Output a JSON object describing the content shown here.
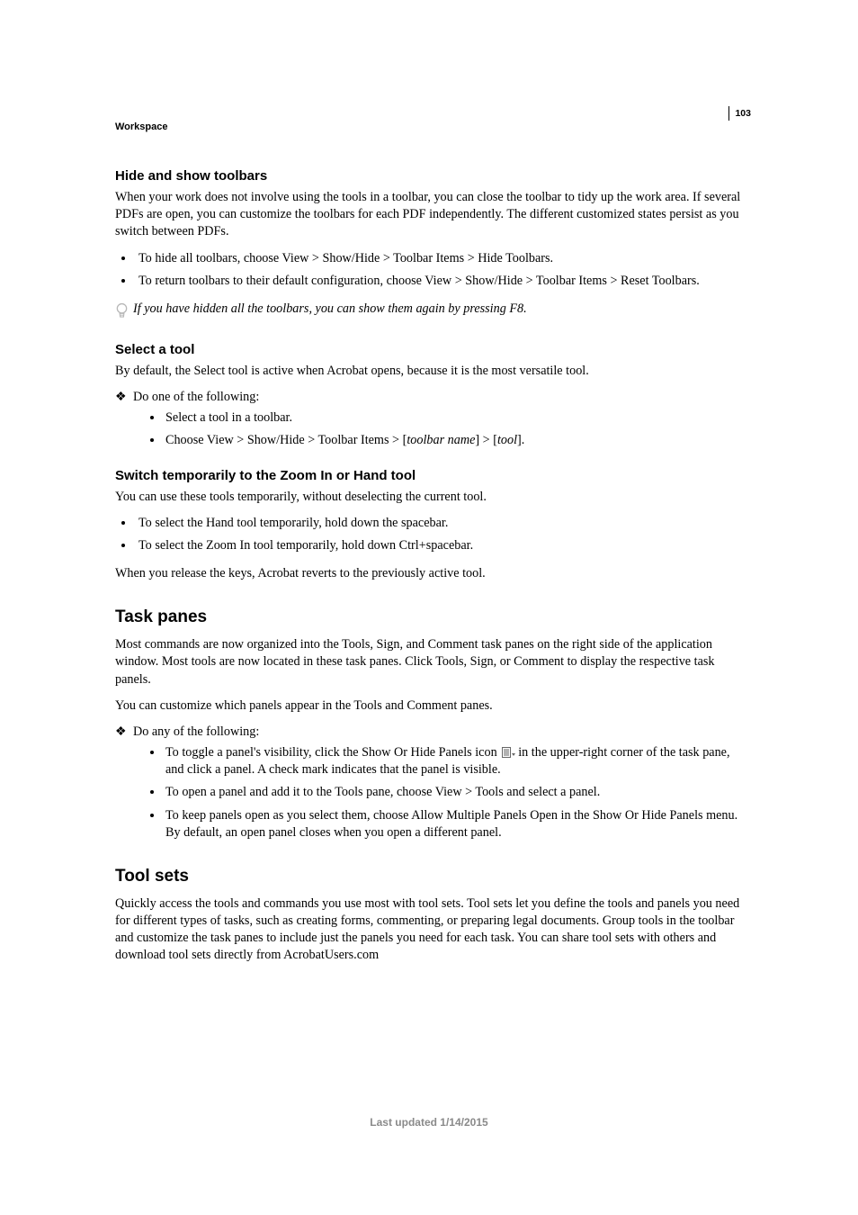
{
  "page_number": "103",
  "section_label": "Workspace",
  "s1": {
    "heading": "Hide and show toolbars",
    "p1": "When your work does not involve using the tools in a toolbar, you can close the toolbar to tidy up the work area. If several PDFs are open, you can customize the toolbars for each PDF independently. The different customized states persist as you switch between PDFs.",
    "b1": "To hide all toolbars, choose View > Show/Hide > Toolbar Items > Hide Toolbars.",
    "b2": "To return toolbars to their default configuration, choose View > Show/Hide > Toolbar Items > Reset Toolbars.",
    "tip": "If you have hidden all the toolbars, you can show them again by pressing F8."
  },
  "s2": {
    "heading": "Select a tool",
    "p1": "By default, the Select tool is active when Acrobat opens, because it is the most versatile tool.",
    "lead": "Do one of the following:",
    "i1": "Select a tool in a toolbar.",
    "i2a": "Choose View > Show/Hide > Toolbar Items > [",
    "i2b": "toolbar name",
    "i2c": "] > [",
    "i2d": "tool",
    "i2e": "]."
  },
  "s3": {
    "heading": "Switch temporarily to the Zoom In or Hand tool",
    "p1": "You can use these tools temporarily, without deselecting the current tool.",
    "b1": "To select the Hand tool temporarily, hold down the spacebar.",
    "b2": "To select the Zoom In tool temporarily, hold down Ctrl+spacebar.",
    "p2": "When you release the keys, Acrobat reverts to the previously active tool."
  },
  "s4": {
    "heading": "Task panes",
    "p1": "Most commands are now organized into the Tools, Sign, and Comment task panes on the right side of the application window. Most tools are now located in these task panes. Click Tools, Sign, or Comment to display the respective task panels.",
    "p2": "You can customize which panels appear in the Tools and Comment panes.",
    "lead": "Do any of the following:",
    "i1a": "To toggle a panel's visibility, click the Show Or Hide Panels icon ",
    "i1b": "in the upper-right corner of the task pane, and click a panel. A check mark indicates that the panel is visible.",
    "i2": "To open a panel and add it to the Tools pane, choose View > Tools and select a panel.",
    "i3": "To keep panels open as you select them, choose Allow Multiple Panels Open in the Show Or Hide Panels menu. By default, an open panel closes when you open a different panel."
  },
  "s5": {
    "heading": "Tool sets",
    "p1": "Quickly access the tools and commands you use most with tool sets. Tool sets let you define the tools and panels you need for different types of tasks, such as creating forms, commenting, or preparing legal documents. Group tools in the toolbar and customize the task panes to include just the panels you need for each task. You can share tool sets with others and download tool sets directly from AcrobatUsers.com"
  },
  "footer": "Last updated 1/14/2015"
}
